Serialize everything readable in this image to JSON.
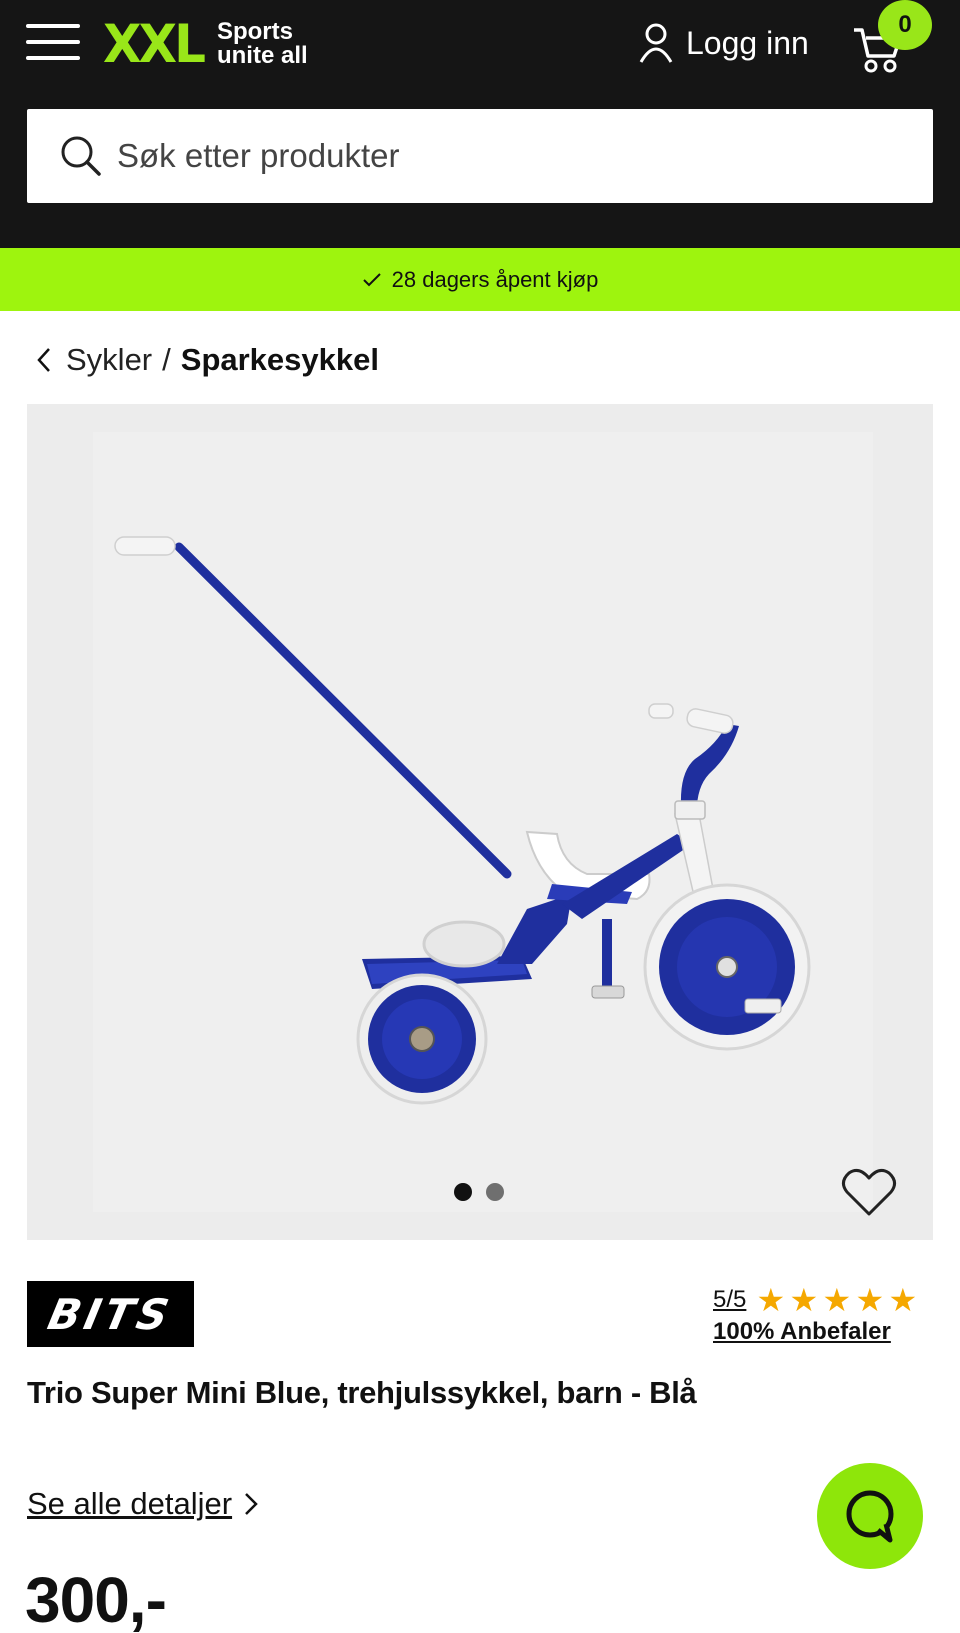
{
  "header": {
    "logo_mark": "XXL",
    "logo_tagline_line1": "Sports",
    "logo_tagline_line2": "unite all",
    "login_label": "Logg inn",
    "cart_count": "0",
    "brand_color": "#99e619",
    "background_color": "#151515"
  },
  "search": {
    "placeholder": "Søk etter produkter"
  },
  "promo": {
    "text": "28 dagers åpent kjøp",
    "background_color": "#9ef40e"
  },
  "breadcrumb": {
    "parent": "Sykler",
    "separator": "/",
    "current": "Sparkesykkel"
  },
  "gallery": {
    "image_count": 2,
    "active_index": 0,
    "image_description_icon": "tricycle-image"
  },
  "product": {
    "brand": "BITS",
    "rating_score": "5/5",
    "stars": 5,
    "star_color": "#f5a800",
    "recommend_text": "100% Anbefaler",
    "title": "Trio Super Mini Blue, trehjulssykkel, barn - Blå",
    "details_link": "Se alle detaljer",
    "price": "300,-"
  },
  "chat": {
    "icon": "chat-icon",
    "color": "#8ee60a"
  }
}
